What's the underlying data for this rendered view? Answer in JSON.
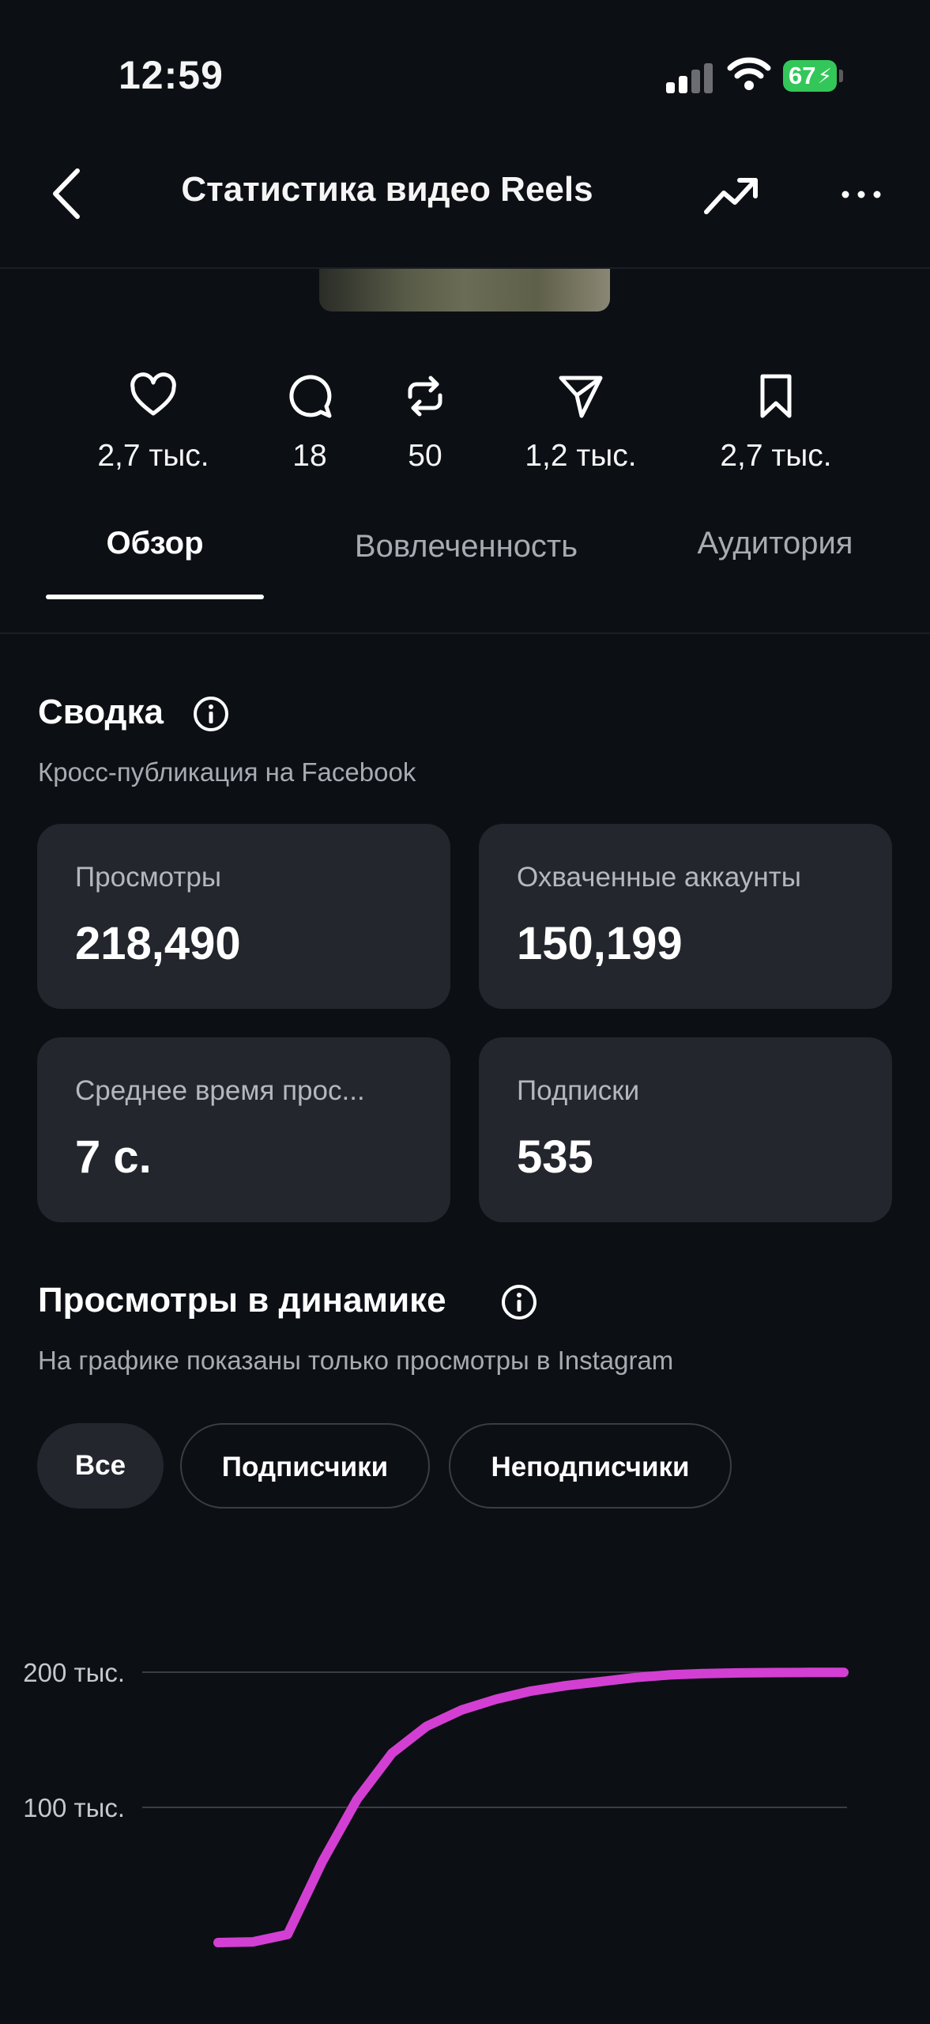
{
  "status_bar": {
    "time": "12:59",
    "battery": "67"
  },
  "nav": {
    "title": "Статистика видео Reels"
  },
  "metrics": [
    {
      "icon": "heart-icon",
      "value": "2,7 тыс."
    },
    {
      "icon": "comment-icon",
      "value": "18"
    },
    {
      "icon": "repost-icon",
      "value": "50"
    },
    {
      "icon": "share-icon",
      "value": "1,2 тыс."
    },
    {
      "icon": "bookmark-icon",
      "value": "2,7 тыс."
    }
  ],
  "tabs": [
    {
      "label": "Обзор",
      "active": true
    },
    {
      "label": "Вовлеченность",
      "active": false
    },
    {
      "label": "Аудитория",
      "active": false
    }
  ],
  "summary": {
    "title": "Сводка",
    "subtitle": "Кросс-публикация на Facebook",
    "cards": [
      {
        "label": "Просмотры",
        "value": "218,490"
      },
      {
        "label": "Охваченные аккаунты",
        "value": "150,199"
      },
      {
        "label": "Среднее время прос...",
        "value": "7 с."
      },
      {
        "label": "Подписки",
        "value": "535"
      }
    ]
  },
  "views_dynamics": {
    "title": "Просмотры в динамике",
    "subtitle": "На графике показаны только просмотры в Instagram",
    "filters": [
      {
        "label": "Все",
        "selected": true
      },
      {
        "label": "Подписчики",
        "selected": false
      },
      {
        "label": "Неподписчики",
        "selected": false
      }
    ]
  },
  "chart_data": {
    "type": "line",
    "title": "",
    "xlabel": "",
    "ylabel": "",
    "ylim": [
      0,
      200000
    ],
    "y_ticks": [
      "100 тыс.",
      "200 тыс."
    ],
    "y_tick_values": [
      100000,
      200000
    ],
    "grid": true,
    "line_color": "#d33fd3",
    "series": [
      {
        "values": [
          0,
          500,
          6000,
          60000,
          106000,
          140000,
          160000,
          172000,
          180000,
          186000,
          190000,
          193000,
          196000,
          198000,
          199000,
          199500,
          199700,
          199800,
          199800
        ]
      }
    ]
  }
}
